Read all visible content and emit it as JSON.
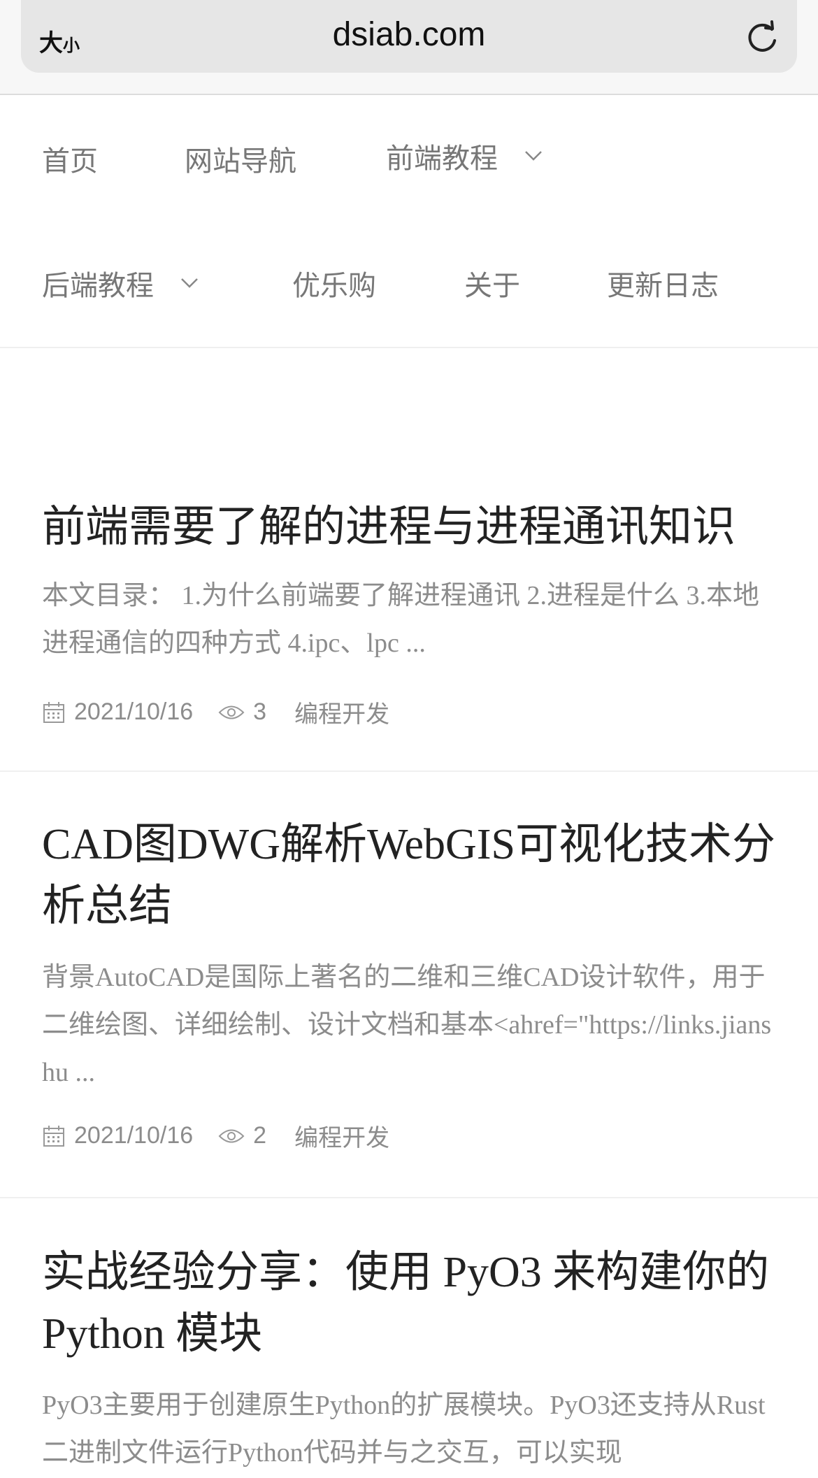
{
  "browser": {
    "text_size_big": "大",
    "text_size_small": "小",
    "url": "dsiab.com"
  },
  "nav": {
    "items": [
      {
        "label": "首页"
      },
      {
        "label": "网站导航"
      },
      {
        "label": "前端教程"
      },
      {
        "label": "后端教程"
      },
      {
        "label": "优乐购"
      },
      {
        "label": "关于"
      },
      {
        "label": "更新日志"
      }
    ]
  },
  "articles": [
    {
      "title": "前端需要了解的进程与进程通讯知识",
      "excerpt": "本文目录： 1.为什么前端要了解进程通讯 2.进程是什么 3.本地进程通信的四种方式 4.ipc、lpc ...",
      "date": "2021/10/16",
      "views": "3",
      "category": "编程开发"
    },
    {
      "title": "CAD图DWG解析WebGIS可视化技术分析总结",
      "excerpt": "背景AutoCAD是国际上著名的二维和三维CAD设计软件，用于二维绘图、详细绘制、设计文档和基本<ahref=\"https://links.jianshu ...",
      "date": "2021/10/16",
      "views": "2",
      "category": "编程开发"
    },
    {
      "title": "实战经验分享：使用 PyO3 来构建你的 Python 模块",
      "excerpt": "PyO3主要用于创建原生Python的扩展模块。PyO3还支持从Rust二进制文件运行Python代码并与之交互，可以实现"
    }
  ]
}
